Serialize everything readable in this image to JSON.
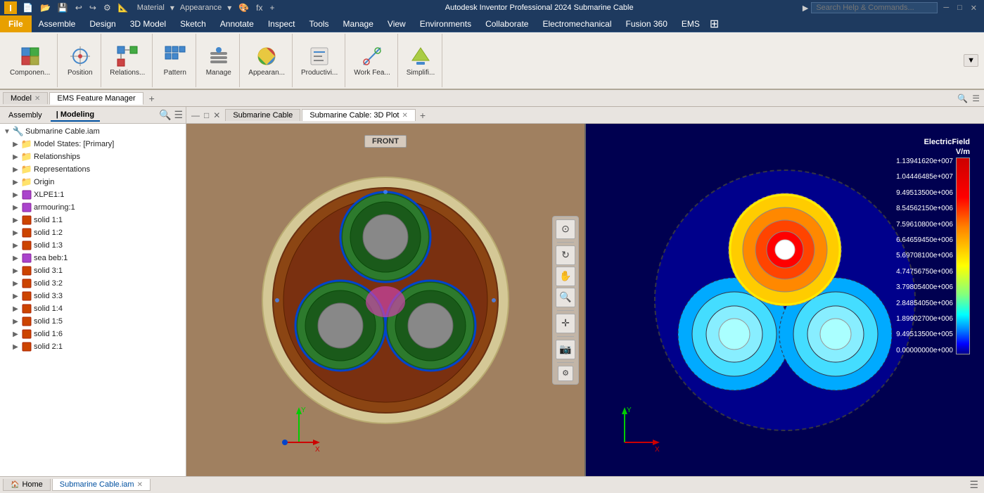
{
  "titlebar": {
    "logo": "I",
    "quick_access": [
      "new",
      "open",
      "save",
      "undo",
      "redo",
      "properties",
      "measure"
    ],
    "material_label": "Material",
    "appearance_label": "Appearance",
    "app_title": "Autodesk Inventor Professional 2024    Submarine Cable",
    "search_placeholder": "Search Help & Commands...",
    "win_controls": [
      "─",
      "□",
      "✕"
    ]
  },
  "menubar": {
    "file_label": "File",
    "items": [
      "Assemble",
      "Design",
      "3D Model",
      "Sketch",
      "Annotate",
      "Inspect",
      "Tools",
      "Manage",
      "View",
      "Environments",
      "Collaborate",
      "Electromechanical",
      "Fusion 360",
      "EMS"
    ]
  },
  "ribbon": {
    "groups": [
      {
        "id": "component",
        "buttons": [
          {
            "icon": "⬛",
            "label": "Componen..."
          }
        ]
      },
      {
        "id": "position",
        "buttons": [
          {
            "icon": "⬛",
            "label": "Position"
          }
        ]
      },
      {
        "id": "relationships",
        "buttons": [
          {
            "icon": "⬛",
            "label": "Relations..."
          }
        ]
      },
      {
        "id": "pattern",
        "buttons": [
          {
            "icon": "⬛",
            "label": "Pattern"
          }
        ]
      },
      {
        "id": "manage",
        "buttons": [
          {
            "icon": "⬛",
            "label": "Manage"
          }
        ]
      },
      {
        "id": "appearance",
        "buttons": [
          {
            "icon": "⬛",
            "label": "Appearan..."
          }
        ]
      },
      {
        "id": "productivity",
        "buttons": [
          {
            "icon": "⬛",
            "label": "Productivi..."
          }
        ]
      },
      {
        "id": "workfeatures",
        "buttons": [
          {
            "icon": "⬛",
            "label": "Work Fea..."
          }
        ]
      },
      {
        "id": "simplify",
        "buttons": [
          {
            "icon": "⬛",
            "label": "Simplifi..."
          }
        ]
      }
    ]
  },
  "sidebar": {
    "tabs": [
      {
        "id": "model",
        "label": "Model",
        "active": true
      },
      {
        "id": "ems",
        "label": "EMS Feature Manager",
        "active": false
      }
    ],
    "subtabs": [
      {
        "id": "assembly",
        "label": "Assembly",
        "active": false
      },
      {
        "id": "modeling",
        "label": "Modeling",
        "active": true
      }
    ],
    "tree": [
      {
        "id": "root",
        "label": "Submarine Cable.iam",
        "icon": "assembly",
        "expand": true,
        "indent": 0
      },
      {
        "id": "model-states",
        "label": "Model States: [Primary]",
        "icon": "folder",
        "expand": false,
        "indent": 1
      },
      {
        "id": "relationships",
        "label": "Relationships",
        "icon": "folder",
        "expand": false,
        "indent": 1
      },
      {
        "id": "representations",
        "label": "Representations",
        "icon": "folder",
        "expand": false,
        "indent": 1
      },
      {
        "id": "origin",
        "label": "Origin",
        "icon": "folder",
        "expand": false,
        "indent": 1
      },
      {
        "id": "xlpe1",
        "label": "XLPE1:1",
        "icon": "solid",
        "expand": false,
        "indent": 1
      },
      {
        "id": "armouring1",
        "label": "armouring:1",
        "icon": "solid",
        "expand": false,
        "indent": 1
      },
      {
        "id": "solid11",
        "label": "solid 1:1",
        "icon": "solid",
        "expand": false,
        "indent": 1
      },
      {
        "id": "solid12",
        "label": "solid 1:2",
        "icon": "solid",
        "expand": false,
        "indent": 1
      },
      {
        "id": "solid13",
        "label": "solid 1:3",
        "icon": "solid",
        "expand": false,
        "indent": 1
      },
      {
        "id": "seabeb1",
        "label": "sea beb:1",
        "icon": "solid",
        "expand": false,
        "indent": 1
      },
      {
        "id": "solid31",
        "label": "solid 3:1",
        "icon": "solid",
        "expand": false,
        "indent": 1
      },
      {
        "id": "solid32",
        "label": "solid 3:2",
        "icon": "solid",
        "expand": false,
        "indent": 1
      },
      {
        "id": "solid33",
        "label": "solid 3:3",
        "icon": "solid",
        "expand": false,
        "indent": 1
      },
      {
        "id": "solid14",
        "label": "solid 1:4",
        "icon": "solid",
        "expand": false,
        "indent": 1
      },
      {
        "id": "solid15",
        "label": "solid 1:5",
        "icon": "solid",
        "expand": false,
        "indent": 1
      },
      {
        "id": "solid16",
        "label": "solid 1:6",
        "icon": "solid",
        "expand": false,
        "indent": 1
      },
      {
        "id": "solid21",
        "label": "solid 2:1",
        "icon": "solid",
        "expand": false,
        "indent": 1
      }
    ]
  },
  "viewport": {
    "left_tab": "Submarine Cable",
    "right_tab": "Submarine Cable: 3D Plot",
    "front_label": "FRONT"
  },
  "bottom_tabs": [
    {
      "id": "home",
      "label": "Home",
      "icon": "🏠",
      "active": false
    },
    {
      "id": "submarine-cable",
      "label": "Submarine Cable.iam",
      "icon": "",
      "active": true,
      "closeable": true
    }
  ],
  "legend": {
    "title": "ElectricField",
    "unit": "V/m",
    "values": [
      "1.13941620e+007",
      "1.04446485e+007",
      "9.49513500e+006",
      "8.54562150e+006",
      "7.59610800e+006",
      "6.64659450e+006",
      "5.69708100e+006",
      "4.74756750e+006",
      "3.79805400e+006",
      "2.84854050e+006",
      "1.89902700e+006",
      "9.49513500e+005",
      "0.00000000e+000"
    ]
  }
}
